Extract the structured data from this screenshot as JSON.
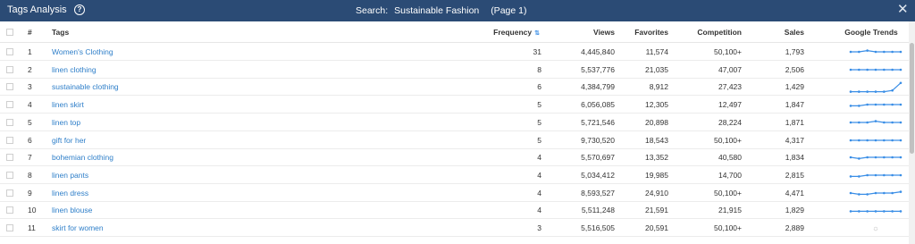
{
  "window": {
    "title": "Tags Analysis",
    "help_icon": "?",
    "search_label": "Search:",
    "search_query": "Sustainable Fashion",
    "page_label": "(Page 1)",
    "close_icon": "✕"
  },
  "colors": {
    "titlebar": "#2b4b75",
    "link": "#2f7fc9",
    "trend_line": "#3a8ee6"
  },
  "table": {
    "headers": {
      "num": "#",
      "tags": "Tags",
      "frequency": "Frequency",
      "views": "Views",
      "favorites": "Favorites",
      "competition": "Competition",
      "sales": "Sales",
      "trends": "Google Trends"
    },
    "sorted_column": "frequency",
    "rows": [
      {
        "num": "1",
        "tag": "Women's Clothing",
        "frequency": "31",
        "views": "4,445,840",
        "favorites": "11,574",
        "competition": "50,100+",
        "sales": "1,793",
        "trend": [
          5,
          5,
          6,
          5,
          5,
          5,
          5
        ]
      },
      {
        "num": "2",
        "tag": "linen clothing",
        "frequency": "8",
        "views": "5,537,776",
        "favorites": "21,035",
        "competition": "47,007",
        "sales": "2,506",
        "trend": [
          5,
          5,
          5,
          5,
          5,
          5,
          5
        ]
      },
      {
        "num": "3",
        "tag": "sustainable clothing",
        "frequency": "6",
        "views": "4,384,799",
        "favorites": "8,912",
        "competition": "27,423",
        "sales": "1,429",
        "trend": [
          1,
          1,
          1,
          1,
          1,
          2,
          8
        ]
      },
      {
        "num": "4",
        "tag": "linen skirt",
        "frequency": "5",
        "views": "6,056,085",
        "favorites": "12,305",
        "competition": "12,497",
        "sales": "1,847",
        "trend": [
          4,
          4,
          5,
          5,
          5,
          5,
          5
        ]
      },
      {
        "num": "5",
        "tag": "linen top",
        "frequency": "5",
        "views": "5,721,546",
        "favorites": "20,898",
        "competition": "28,224",
        "sales": "1,871",
        "trend": [
          5,
          5,
          5,
          6,
          5,
          5,
          5
        ]
      },
      {
        "num": "6",
        "tag": "gift for her",
        "frequency": "5",
        "views": "9,730,520",
        "favorites": "18,543",
        "competition": "50,100+",
        "sales": "4,317",
        "trend": [
          5,
          5,
          5,
          5,
          5,
          5,
          5
        ]
      },
      {
        "num": "7",
        "tag": "bohemian clothing",
        "frequency": "4",
        "views": "5,570,697",
        "favorites": "13,352",
        "competition": "40,580",
        "sales": "1,834",
        "trend": [
          5,
          4,
          5,
          5,
          5,
          5,
          5
        ]
      },
      {
        "num": "8",
        "tag": "linen pants",
        "frequency": "4",
        "views": "5,034,412",
        "favorites": "19,985",
        "competition": "14,700",
        "sales": "2,815",
        "trend": [
          4,
          4,
          5,
          5,
          5,
          5,
          5
        ]
      },
      {
        "num": "9",
        "tag": "linen dress",
        "frequency": "4",
        "views": "8,593,527",
        "favorites": "24,910",
        "competition": "50,100+",
        "sales": "4,471",
        "trend": [
          5,
          4,
          4,
          5,
          5,
          5,
          6
        ]
      },
      {
        "num": "10",
        "tag": "linen blouse",
        "frequency": "4",
        "views": "5,511,248",
        "favorites": "21,591",
        "competition": "21,915",
        "sales": "1,829",
        "trend": [
          4,
          4,
          4,
          4,
          4,
          4,
          4
        ]
      },
      {
        "num": "11",
        "tag": "skirt for women",
        "frequency": "3",
        "views": "5,516,505",
        "favorites": "20,591",
        "competition": "50,100+",
        "sales": "2,889",
        "trend": null,
        "trend_status_icon": "☼"
      }
    ]
  }
}
